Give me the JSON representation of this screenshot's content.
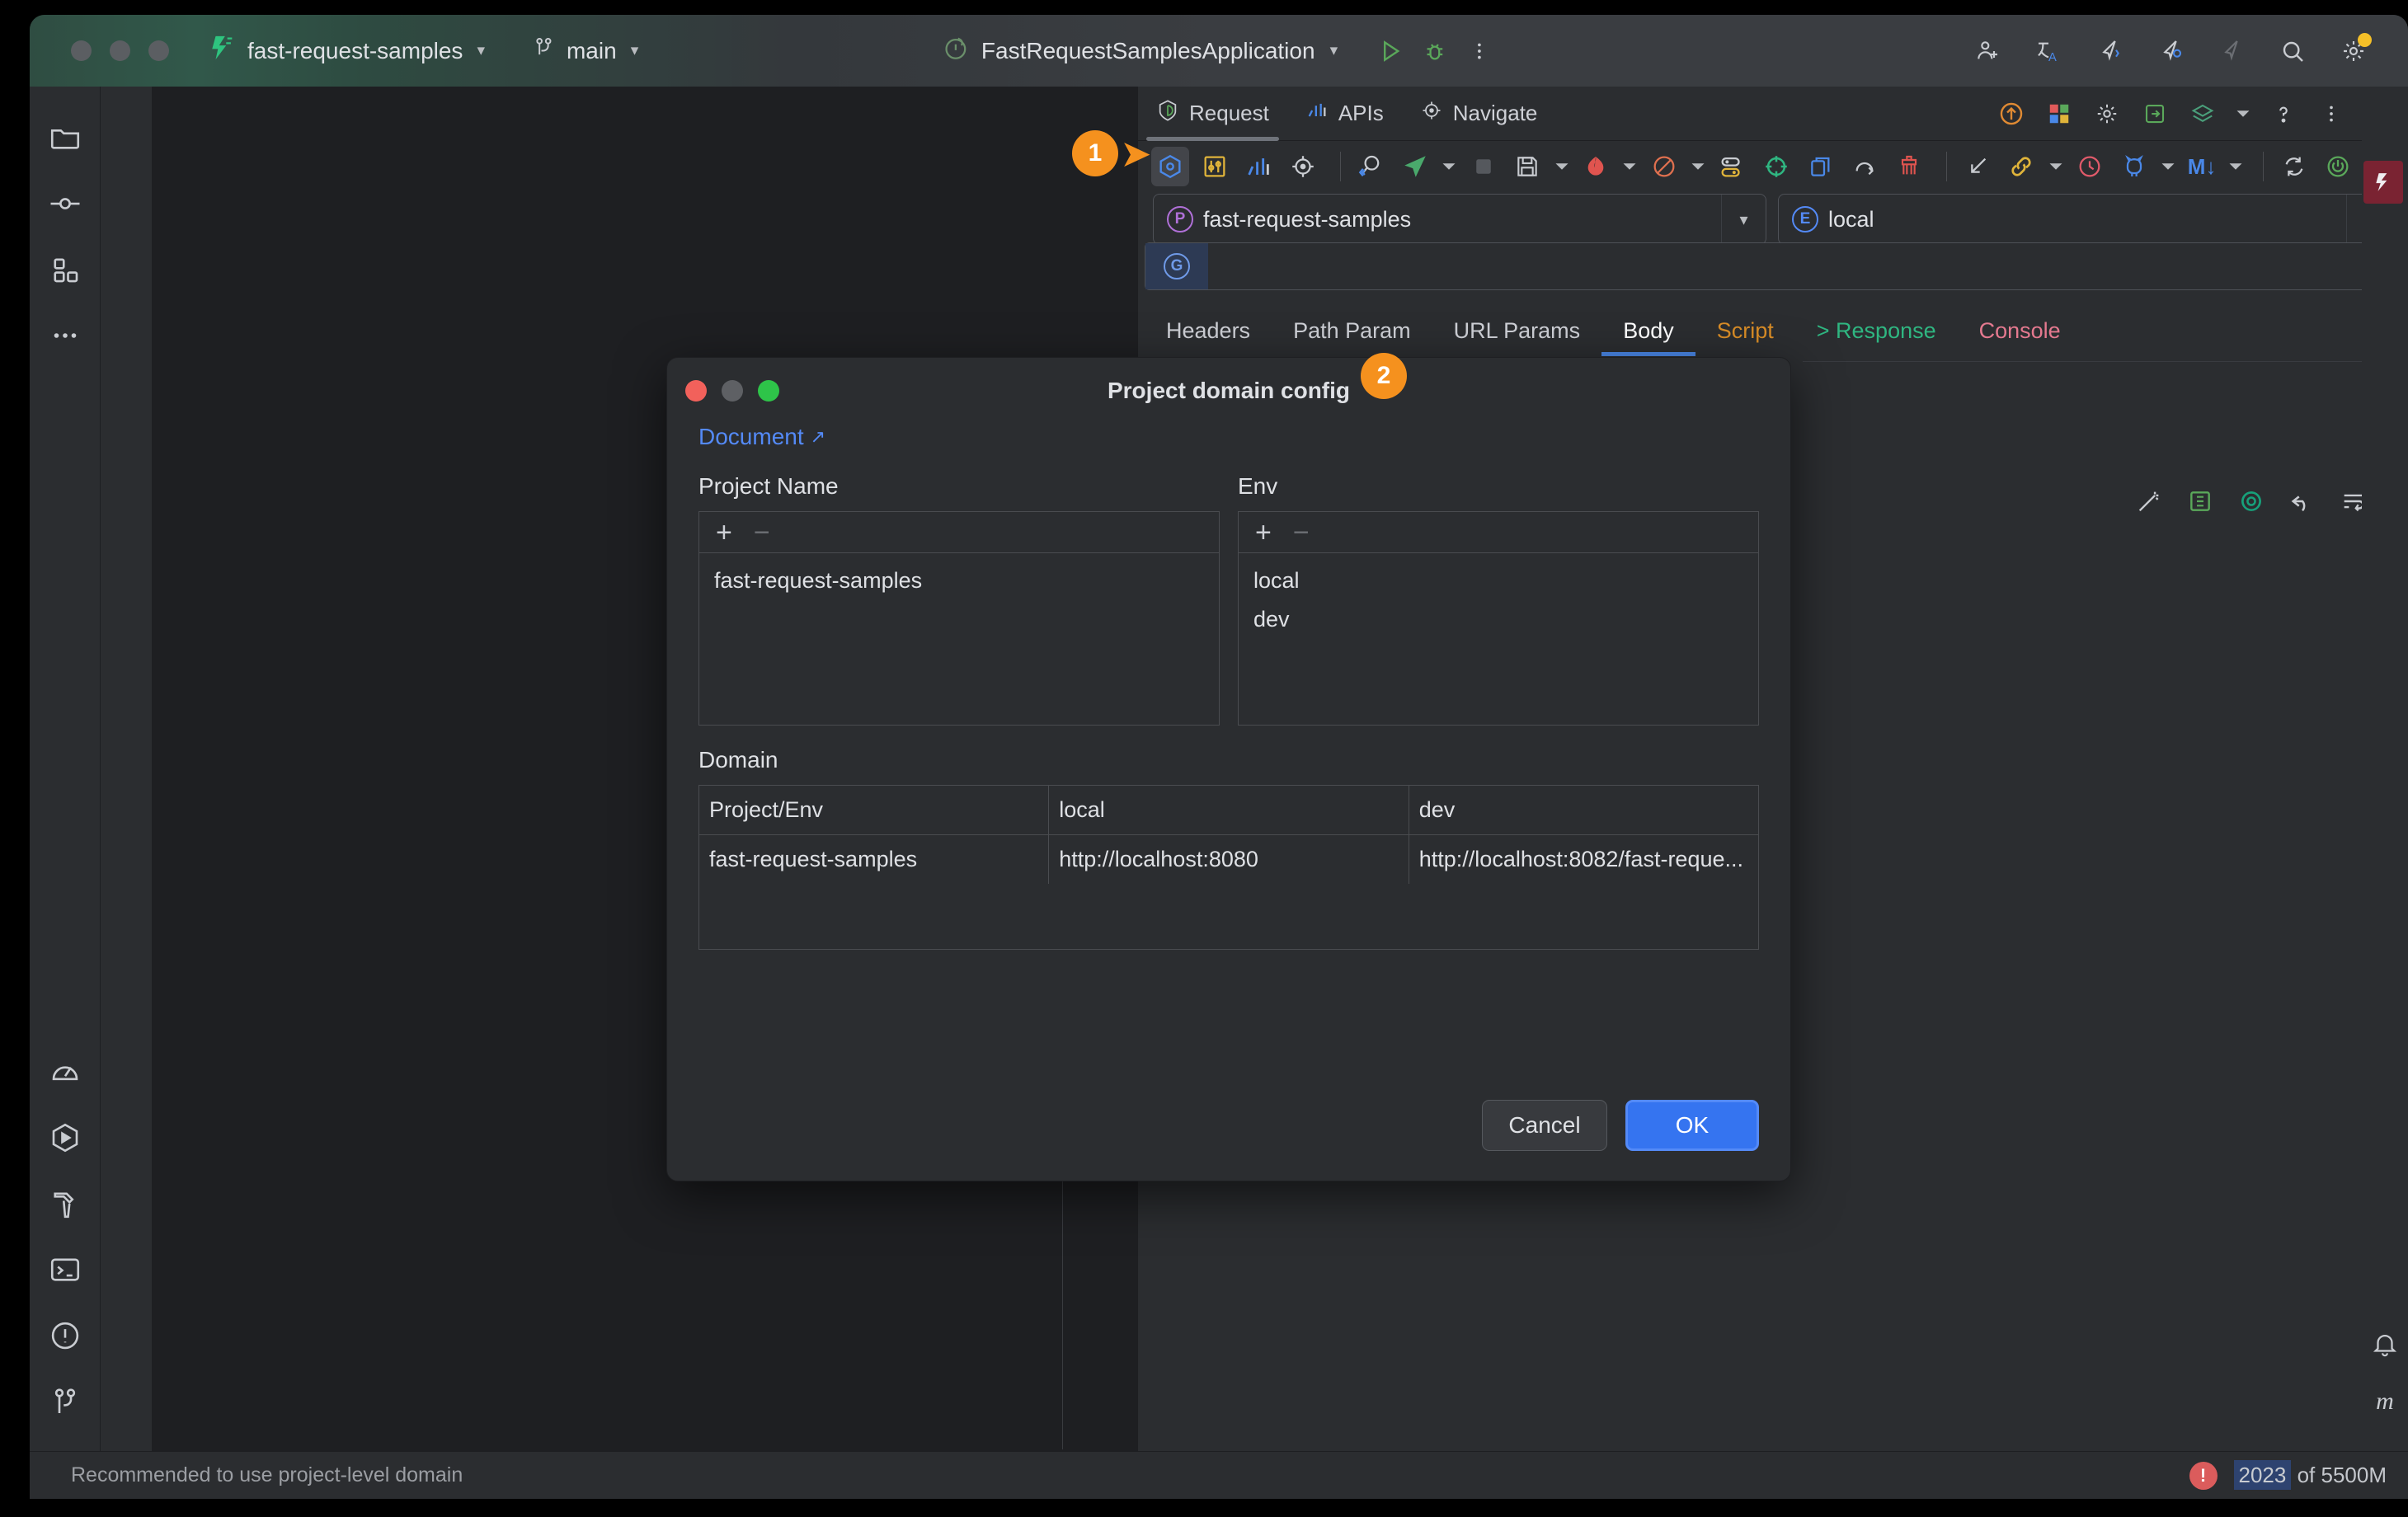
{
  "titlebar": {
    "project_name": "fast-request-samples",
    "branch": "main",
    "run_config": "FastRequestSamplesApplication",
    "icons": [
      "run-icon",
      "debug-icon",
      "more-vertical-icon",
      "add-user-icon",
      "translate-icon",
      "ai-assistant-icon",
      "ai-chat-icon",
      "ai-disabled-icon",
      "search-icon",
      "settings-icon"
    ]
  },
  "left_rail": {
    "top_items": [
      "folder-icon",
      "commit-icon",
      "structure-icon",
      "more-tools-icon"
    ],
    "bottom_items": [
      "profiler-icon",
      "run-tool-icon",
      "build-icon",
      "terminal-icon",
      "problems-icon",
      "git-icon"
    ]
  },
  "tool_window": {
    "tabs": [
      {
        "label": "Request",
        "icon": "request-shield-icon",
        "active": true
      },
      {
        "label": "APIs",
        "icon": "apis-bars-icon",
        "active": false
      },
      {
        "label": "Navigate",
        "icon": "navigate-target-icon",
        "active": false
      }
    ],
    "tab_actions": [
      "send-up-icon",
      "plugin-icon",
      "gear-icon",
      "export-icon",
      "layers-icon",
      "layers-caret-icon",
      "help-icon",
      "more-vertical-icon",
      "minimize-icon"
    ],
    "toolbar": [
      {
        "name": "domain-config-icon",
        "selected": true
      },
      {
        "name": "settings-sliders-icon",
        "selected": false
      },
      {
        "name": "statistics-icon",
        "selected": false
      },
      {
        "name": "locate-icon",
        "selected": false
      },
      {
        "name": "separator",
        "selected": false
      },
      {
        "name": "search-code-icon",
        "selected": false
      },
      {
        "name": "send-request-icon",
        "selected": false
      },
      {
        "name": "send-caret",
        "selected": false
      },
      {
        "name": "stop-icon",
        "selected": false
      },
      {
        "name": "save-icon",
        "selected": false
      },
      {
        "name": "save-caret",
        "selected": false
      },
      {
        "name": "postman-icon",
        "selected": false
      },
      {
        "name": "postman-caret",
        "selected": false
      },
      {
        "name": "disable-icon",
        "selected": false
      },
      {
        "name": "disable-caret",
        "selected": false
      },
      {
        "name": "toggles-icon",
        "selected": false
      },
      {
        "name": "target-green-icon",
        "selected": false
      },
      {
        "name": "copy-icon",
        "selected": false
      },
      {
        "name": "redo-icon",
        "selected": false
      },
      {
        "name": "clear-icon",
        "selected": false
      },
      {
        "name": "separator",
        "selected": false
      },
      {
        "name": "collapse-icon",
        "selected": false
      },
      {
        "name": "link-icon",
        "selected": false
      },
      {
        "name": "link-caret",
        "selected": false
      },
      {
        "name": "history-icon",
        "selected": false
      },
      {
        "name": "github-icon",
        "selected": false
      },
      {
        "name": "github-caret",
        "selected": false
      },
      {
        "name": "markdown-icon",
        "selected": false
      },
      {
        "name": "markdown-caret",
        "selected": false
      },
      {
        "name": "separator",
        "selected": false
      },
      {
        "name": "sync-icon",
        "selected": false
      },
      {
        "name": "power-icon",
        "selected": false
      },
      {
        "name": "puzzle-icon",
        "selected": false
      }
    ],
    "project_select": {
      "badge": "P",
      "value": "fast-request-samples",
      "badge_color": "#b070d8"
    },
    "env_select": {
      "badge": "E",
      "value": "local",
      "badge_color": "#548af7"
    },
    "url_bar": {
      "method_badge": "G",
      "value": "",
      "placeholder": ""
    },
    "request_tabs": [
      {
        "label": "Headers",
        "color": "#ced0d6",
        "active": false
      },
      {
        "label": "Path Param",
        "color": "#ced0d6",
        "active": false
      },
      {
        "label": "URL Params",
        "color": "#ced0d6",
        "active": false
      },
      {
        "label": "Body",
        "color": "#ffffff",
        "active": true
      },
      {
        "label": "Script",
        "color": "#d98d27",
        "active": false
      },
      {
        "label": "> Response",
        "color": "#2fb681",
        "active": false
      },
      {
        "label": "Console",
        "color": "#e4798f",
        "active": false
      }
    ],
    "response_toolbar": [
      "magic-wand-icon",
      "format-icon",
      "openai-icon",
      "undo-icon",
      "wrap-icon",
      "check-icon"
    ]
  },
  "dialog": {
    "title": "Project domain config",
    "document_link": "Document",
    "project_name_label": "Project Name",
    "env_label": "Env",
    "domain_label": "Domain",
    "project_names": [
      "fast-request-samples"
    ],
    "envs": [
      "local",
      "dev"
    ],
    "domain_table": {
      "headers": [
        "Project/Env",
        "local",
        "dev"
      ],
      "rows": [
        [
          "fast-request-samples",
          "http://localhost:8080",
          "http://localhost:8082/fast-reque..."
        ]
      ]
    },
    "cancel_label": "Cancel",
    "ok_label": "OK"
  },
  "annotations": [
    {
      "number": "1"
    },
    {
      "number": "2"
    }
  ],
  "statusbar": {
    "message": "Recommended to use project-level domain",
    "memory_used": "2023",
    "memory_total": "of 5500M"
  },
  "colors": {
    "accent": "#3574f0",
    "annotation": "#f5911e",
    "brand_green": "#2ec449",
    "panel_bg": "#2b2d30",
    "editor_bg": "#1e1f22"
  }
}
